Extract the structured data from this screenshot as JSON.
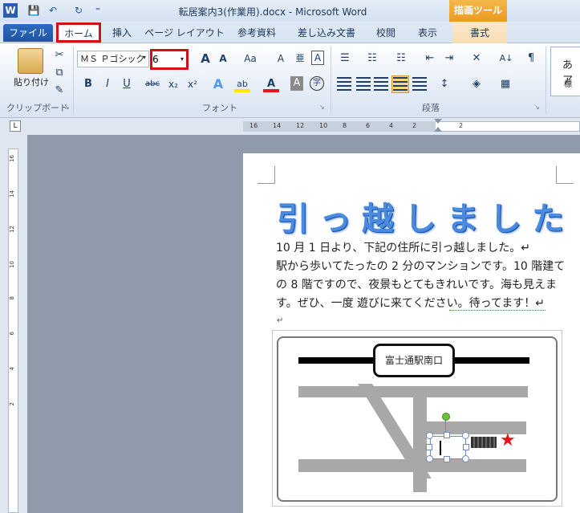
{
  "window": {
    "title": "転居案内3(作業用).docx - Microsoft Word",
    "context_tab_group": "描画ツール"
  },
  "quick_access": {
    "word_icon": "W",
    "save": "💾",
    "undo": "↶",
    "redo": "↻",
    "more": "⁼"
  },
  "tabs": [
    {
      "label": "ファイル"
    },
    {
      "label": "ホーム"
    },
    {
      "label": "挿入"
    },
    {
      "label": "ページ レイアウト"
    },
    {
      "label": "参考資料"
    },
    {
      "label": "差し込み文書"
    },
    {
      "label": "校閲"
    },
    {
      "label": "表示"
    },
    {
      "label": "書式"
    }
  ],
  "ribbon": {
    "clipboard": {
      "paste_label": "貼り付け",
      "group_label": "クリップボード",
      "cut": "✂",
      "copy": "⧉",
      "format_painter": "✎"
    },
    "font": {
      "name": "ＭＳ Ｐゴシック",
      "size": "6",
      "group_label": "フォント",
      "grow": "A",
      "shrink": "A",
      "case": "Aa",
      "clear": "A",
      "phonetic": "亜",
      "border": "A",
      "bold": "B",
      "italic": "I",
      "underline": "U",
      "strike": "abc",
      "sub": "x₂",
      "sup": "x²",
      "effects": "A",
      "highlight": "ab",
      "color": "A",
      "shade": "A",
      "enclose": "字"
    },
    "paragraph": {
      "group_label": "段落",
      "bullets": "☰",
      "numbering": "☷",
      "multilevel": "☷",
      "decrease_indent": "⇤",
      "increase_indent": "⇥",
      "asian_layout": "✕",
      "sort": "A↓",
      "show_marks": "¶"
    },
    "styles": {
      "sample": "あア",
      "label": "標"
    }
  },
  "rulers": {
    "horizontal_ticks": [
      "16",
      "14",
      "12",
      "10",
      "8",
      "6",
      "4",
      "2",
      "",
      "2"
    ],
    "vertical_ticks": [
      "16",
      "14",
      "12",
      "10",
      "8",
      "6",
      "4",
      "2"
    ]
  },
  "document": {
    "heading": "引っ越しました",
    "lines": [
      "10 月 1 日より、下記の住所に引っ越しました。↵",
      "駅から歩いてたったの 2 分のマンションです。10 階建て",
      "の 8 階ですので、夜景もとてもきれいです。海も見えま",
      "す。ぜひ、一度 遊びに来てください。待ってます！↵"
    ],
    "empty_para_mark": "↵"
  },
  "map": {
    "station_label": "富士通駅南口",
    "star": "★"
  },
  "colors": {
    "accent": "#2b6cc4",
    "highlight_box": "#d10f16",
    "context_tab": "#e99a1f",
    "heading": "#4a8be0",
    "star": "#e8141b"
  }
}
